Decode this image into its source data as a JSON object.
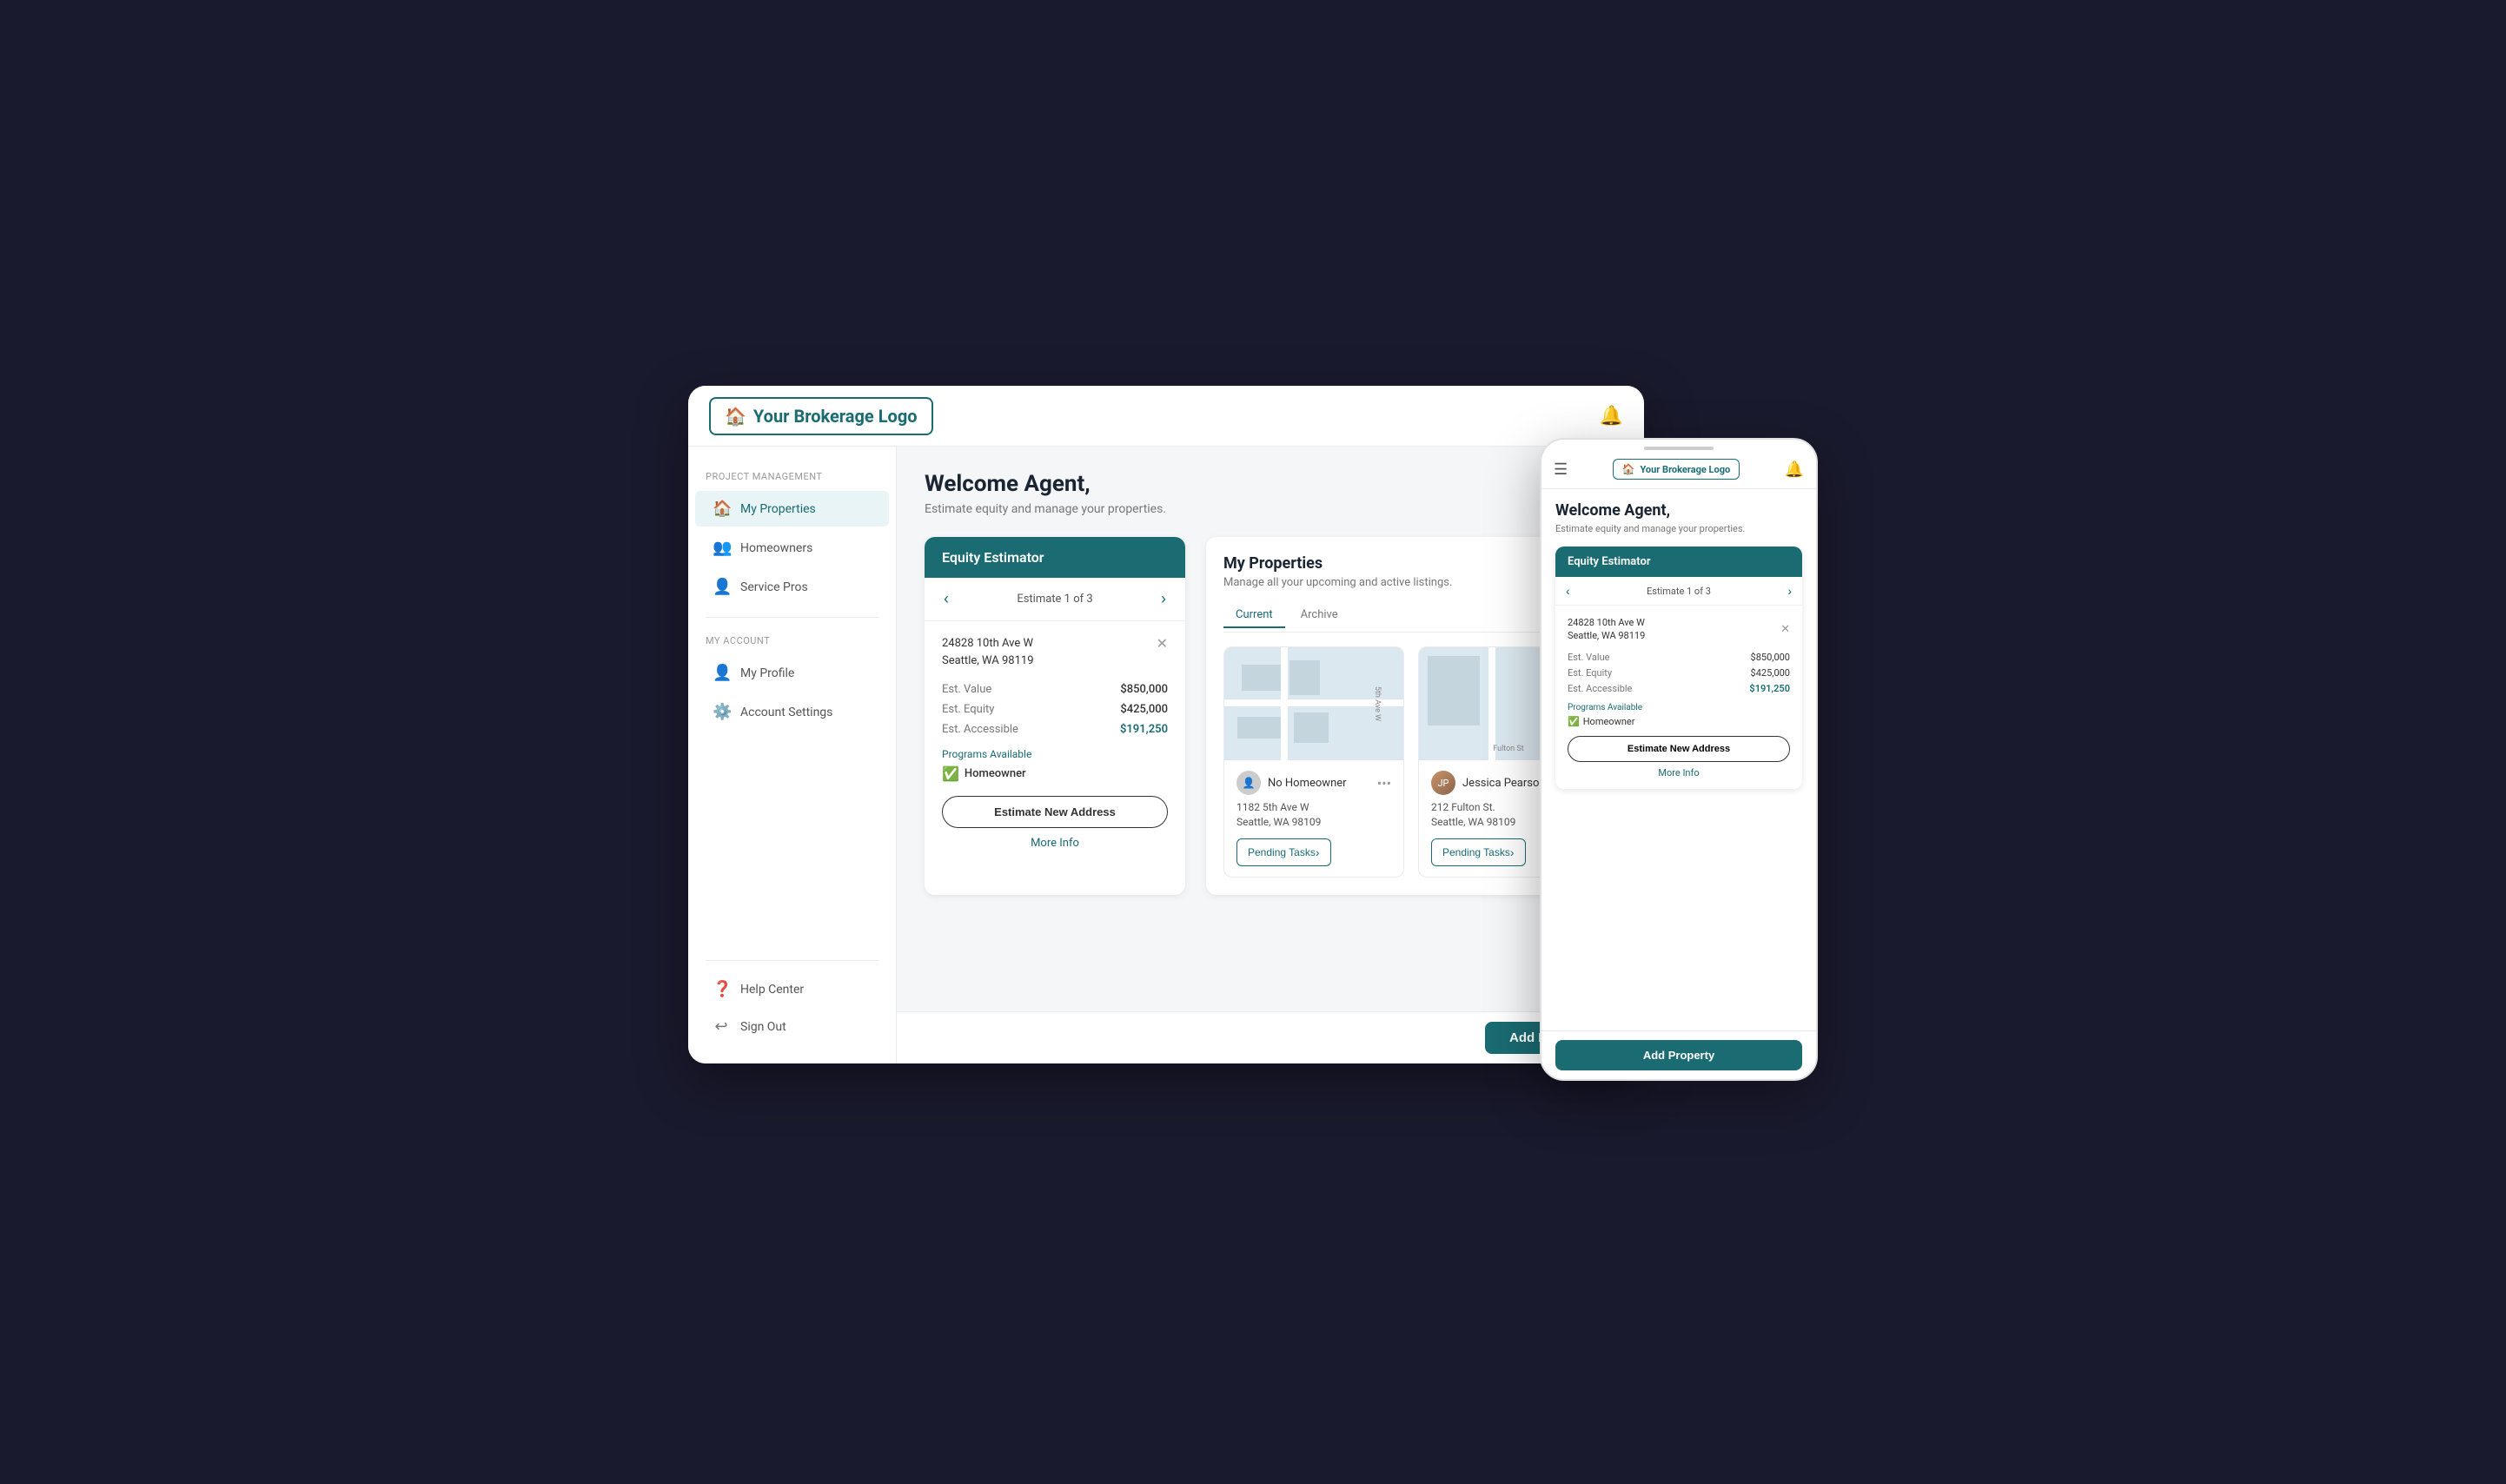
{
  "logo": {
    "text": "Your Brokerage Logo",
    "icon": "🏠"
  },
  "header": {
    "bell_icon": "🔔"
  },
  "sidebar": {
    "section1_label": "Project Management",
    "items": [
      {
        "label": "My Properties",
        "icon": "🏠",
        "active": true
      },
      {
        "label": "Homeowners",
        "icon": "👥",
        "active": false
      },
      {
        "label": "Service Pros",
        "icon": "👤",
        "active": false
      }
    ],
    "section2_label": "My Account",
    "items2": [
      {
        "label": "My Profile",
        "icon": "👤",
        "active": false
      },
      {
        "label": "Account Settings",
        "icon": "⚙️",
        "active": false
      }
    ],
    "bottom_items": [
      {
        "label": "Help Center",
        "icon": "❓"
      },
      {
        "label": "Sign Out",
        "icon": "↩"
      }
    ]
  },
  "welcome": {
    "title": "Welcome Agent,",
    "subtitle": "Estimate equity and manage your properties."
  },
  "equity_estimator": {
    "title": "Equity Estimator",
    "nav_text": "Estimate 1 of 3",
    "address_line1": "24828 10th Ave W",
    "address_line2": "Seattle, WA 98119",
    "est_value_label": "Est. Value",
    "est_value": "$850,000",
    "est_equity_label": "Est. Equity",
    "est_equity": "$425,000",
    "est_accessible_label": "Est. Accessible",
    "est_accessible": "$191,250",
    "programs_label": "Programs Available",
    "program_name": "Homeowner",
    "estimate_btn": "Estimate New Address",
    "more_info_link": "More Info"
  },
  "my_properties": {
    "title": "My Properties",
    "subtitle": "Manage all your upcoming and active listings.",
    "tab_current": "Current",
    "tab_archive": "Archive",
    "properties": [
      {
        "owner": "No Homeowner",
        "has_photo": false,
        "address_line1": "1182 5th Ave W",
        "address_line2": "Seattle, WA 98109",
        "pending_tasks": "Pending Tasks",
        "map_label": "5th Ave W"
      },
      {
        "owner": "Jessica Pearson",
        "has_photo": true,
        "address_line1": "212 Fulton St.",
        "address_line2": "Seattle, WA 98109",
        "pending_tasks": "Pending Tasks",
        "map_label": "Fulton St"
      }
    ]
  },
  "add_property_btn": "Add Property",
  "mobile": {
    "logo_text": "Your Brokerage Logo",
    "welcome_title": "Welcome Agent,",
    "welcome_subtitle": "Estimate equity and manage your properties.",
    "equity_title": "Equity Estimator",
    "nav_text": "Estimate 1 of 3",
    "address_line1": "24828 10th Ave W",
    "address_line2": "Seattle, WA 98119",
    "est_value_label": "Est. Value",
    "est_value": "$850,000",
    "est_equity_label": "Est. Equity",
    "est_equity": "$425,000",
    "est_accessible_label": "Est. Accessible",
    "est_accessible": "$191,250",
    "programs_label": "Programs Available",
    "program_name": "Homeowner",
    "estimate_btn": "Estimate New Address",
    "more_info_link": "More Info",
    "add_property_btn": "Add Property"
  }
}
